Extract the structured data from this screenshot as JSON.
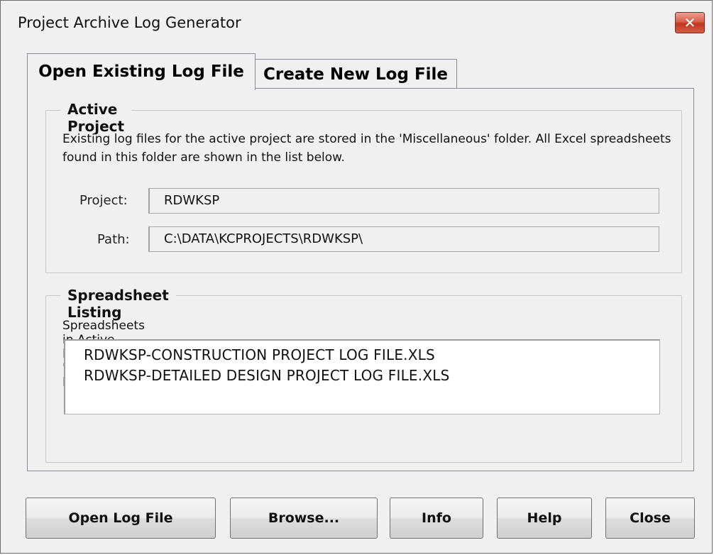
{
  "window": {
    "title": "Project Archive Log Generator",
    "close_glyph": "✕",
    "close_icon": "close-icon",
    "close_color": "#c7452d"
  },
  "tabs": [
    {
      "label": "Open Existing Log File",
      "selected": true
    },
    {
      "label": "Create New Log File",
      "selected": false
    }
  ],
  "active_project": {
    "legend": "Active Project",
    "description": "Existing log files for the active project are stored in the 'Miscellaneous' folder. All Excel spreadsheets found in this folder are shown in the list below.",
    "project_label": "Project:",
    "project_value": "RDWKSP",
    "path_label": "Path:",
    "path_value": "C:\\DATA\\KCPROJECTS\\RDWKSP\\"
  },
  "spreadsheet_listing": {
    "legend": "Spreadsheet Listing",
    "caption": "Spreadsheets in Active Project 'Miscellaneous' Folder",
    "items": [
      "RDWKSP-CONSTRUCTION PROJECT LOG FILE.XLS",
      "RDWKSP-DETAILED DESIGN PROJECT LOG FILE.XLS"
    ]
  },
  "buttons": {
    "open_log": "Open Log File",
    "browse": "Browse...",
    "info": "Info",
    "help": "Help",
    "close": "Close"
  }
}
